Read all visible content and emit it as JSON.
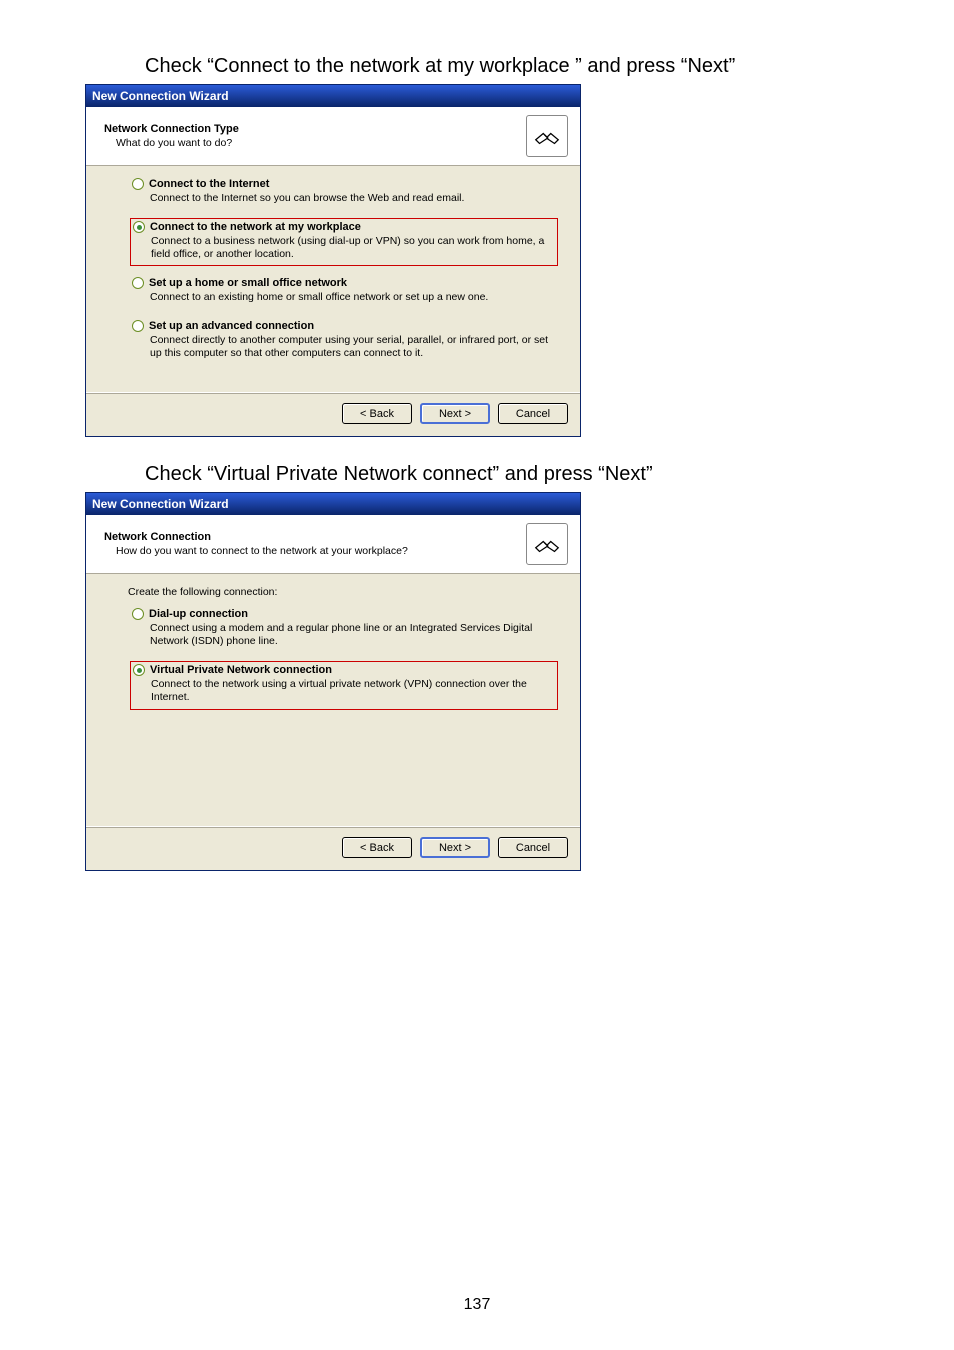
{
  "caption1": "Check “Connect to the network at my workplace ” and press “Next”",
  "caption2": "Check “Virtual Private Network connect” and press “Next”",
  "page_number": "137",
  "buttons": {
    "back": "< Back",
    "next": "Next >",
    "cancel": "Cancel"
  },
  "dialog1": {
    "title": "New Connection Wizard",
    "header_title": "Network Connection Type",
    "header_sub": "What do you want to do?",
    "options": [
      {
        "label": "Connect to the Internet",
        "desc": "Connect to the Internet so you can browse the Web and read email.",
        "checked": false,
        "selected": false
      },
      {
        "label": "Connect to the network at my workplace",
        "desc": "Connect to a business network (using dial-up or VPN) so you can work from home, a field office, or another location.",
        "checked": true,
        "selected": true
      },
      {
        "label": "Set up a home or small office network",
        "desc": "Connect to an existing home or small office network or set up a new one.",
        "checked": false,
        "selected": false
      },
      {
        "label": "Set up an advanced connection",
        "desc": "Connect directly to another computer using your serial, parallel, or infrared port, or set up this computer so that other computers can connect to it.",
        "checked": false,
        "selected": false
      }
    ]
  },
  "dialog2": {
    "title": "New Connection Wizard",
    "header_title": "Network Connection",
    "header_sub": "How do you want to connect to the network at your workplace?",
    "intro": "Create the following connection:",
    "options": [
      {
        "label": "Dial-up connection",
        "desc": "Connect using a modem and a regular phone line or an Integrated Services Digital Network (ISDN) phone line.",
        "checked": false,
        "selected": false
      },
      {
        "label": "Virtual Private Network connection",
        "desc": "Connect to the network using a virtual private network (VPN) connection over the Internet.",
        "checked": true,
        "selected": true
      }
    ]
  }
}
